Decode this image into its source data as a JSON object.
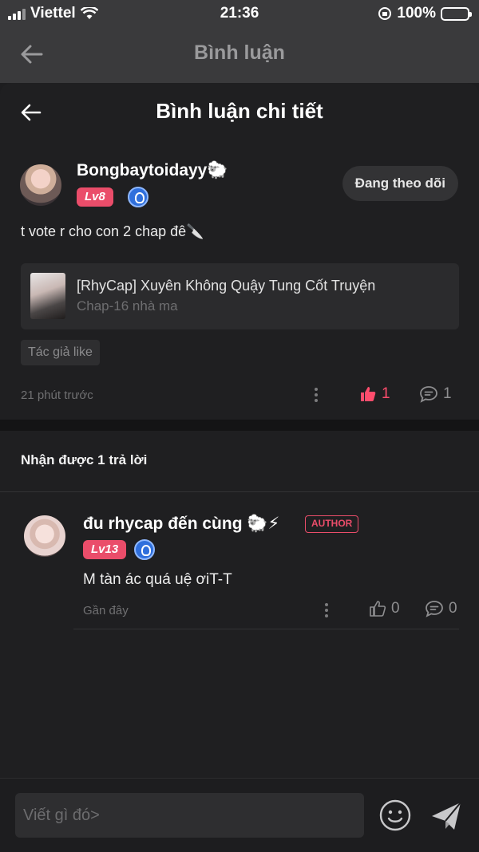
{
  "status_bar": {
    "carrier": "Viettel",
    "time": "21:36",
    "battery": "100%"
  },
  "background_header": {
    "title": "Bình luận"
  },
  "sheet": {
    "title": "Bình luận chi tiết"
  },
  "comment": {
    "username": "Bongbaytoidayy🐑",
    "level": "Lv8",
    "follow_label": "Đang theo dõi",
    "text": "t vote r cho con 2 chap đê🔪",
    "story": {
      "title": "[RhyCap] Xuyên Không Quậy Tung Cốt Truyện",
      "chapter": "Chap-16 nhà ma"
    },
    "tag": "Tác giả like",
    "time": "21 phút trước",
    "likes": "1",
    "replies": "1"
  },
  "replies_header": "Nhận được 1 trả lời",
  "reply": {
    "username": "đu rhycap đến cùng 🐑⚡",
    "badge": "AUTHOR",
    "level": "Lv13",
    "text": "M tàn ác quá uệ ơiT-T",
    "time": "Gần đây",
    "likes": "0",
    "replies": "0"
  },
  "composer": {
    "placeholder": "Viết gì đó>"
  },
  "colors": {
    "accent": "#ea4d6a",
    "like_active": "#ff4d6d",
    "background": "#1f1f21"
  }
}
